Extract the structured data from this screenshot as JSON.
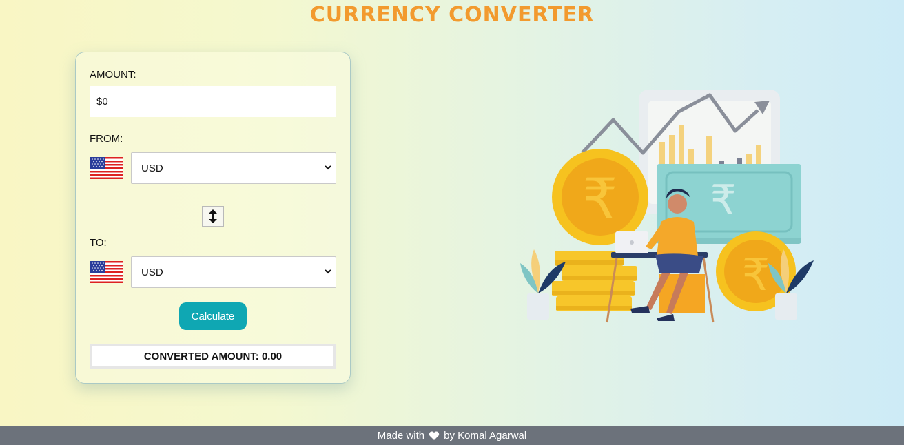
{
  "header": {
    "title": "CURRENCY CONVERTER"
  },
  "converter": {
    "amount_label": "AMOUNT:",
    "amount_value": "$0",
    "from_label": "FROM:",
    "from_currency": "USD",
    "to_label": "TO:",
    "to_currency": "USD",
    "swap_icon": "swap-vertical-arrows",
    "calculate_label": "Calculate",
    "result_text": "CONVERTED AMOUNT: 0.00"
  },
  "footer": {
    "made_with": "Made with",
    "heart_icon": "heart",
    "author": "by Komal Agarwal"
  },
  "colors": {
    "title": "#f29a2e",
    "button": "#0fa7b3",
    "footer": "#6c727b"
  }
}
